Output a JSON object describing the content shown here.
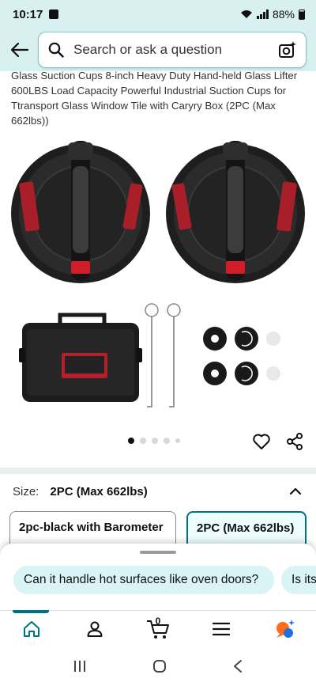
{
  "status": {
    "time": "10:17",
    "battery": "88%"
  },
  "search": {
    "placeholder": "Search or ask a question"
  },
  "product": {
    "title": "Glass Suction Cups 8-inch Heavy Duty Hand-held Glass Lifter 600LBS Load Capacity Powerful Industrial Suction Cups for Ttransport Glass Window Tile with Caryry Box (2PC (Max 662lbs))",
    "image_count": 5,
    "active_image": 1
  },
  "size": {
    "label": "Size:",
    "value": "2PC (Max 662lbs)",
    "options": [
      {
        "label": "2pc-black with Barometer",
        "selected": false
      },
      {
        "label": "2PC (Max 662lbs)",
        "selected": true
      }
    ]
  },
  "suggestions": [
    "Can it handle hot surfaces like oven doors?",
    "Is its"
  ],
  "nav": {
    "cart_count": "0"
  },
  "colors": {
    "header_bg": "#d8f0f0",
    "accent": "#007185",
    "chip_bg": "#d9f3f6"
  }
}
